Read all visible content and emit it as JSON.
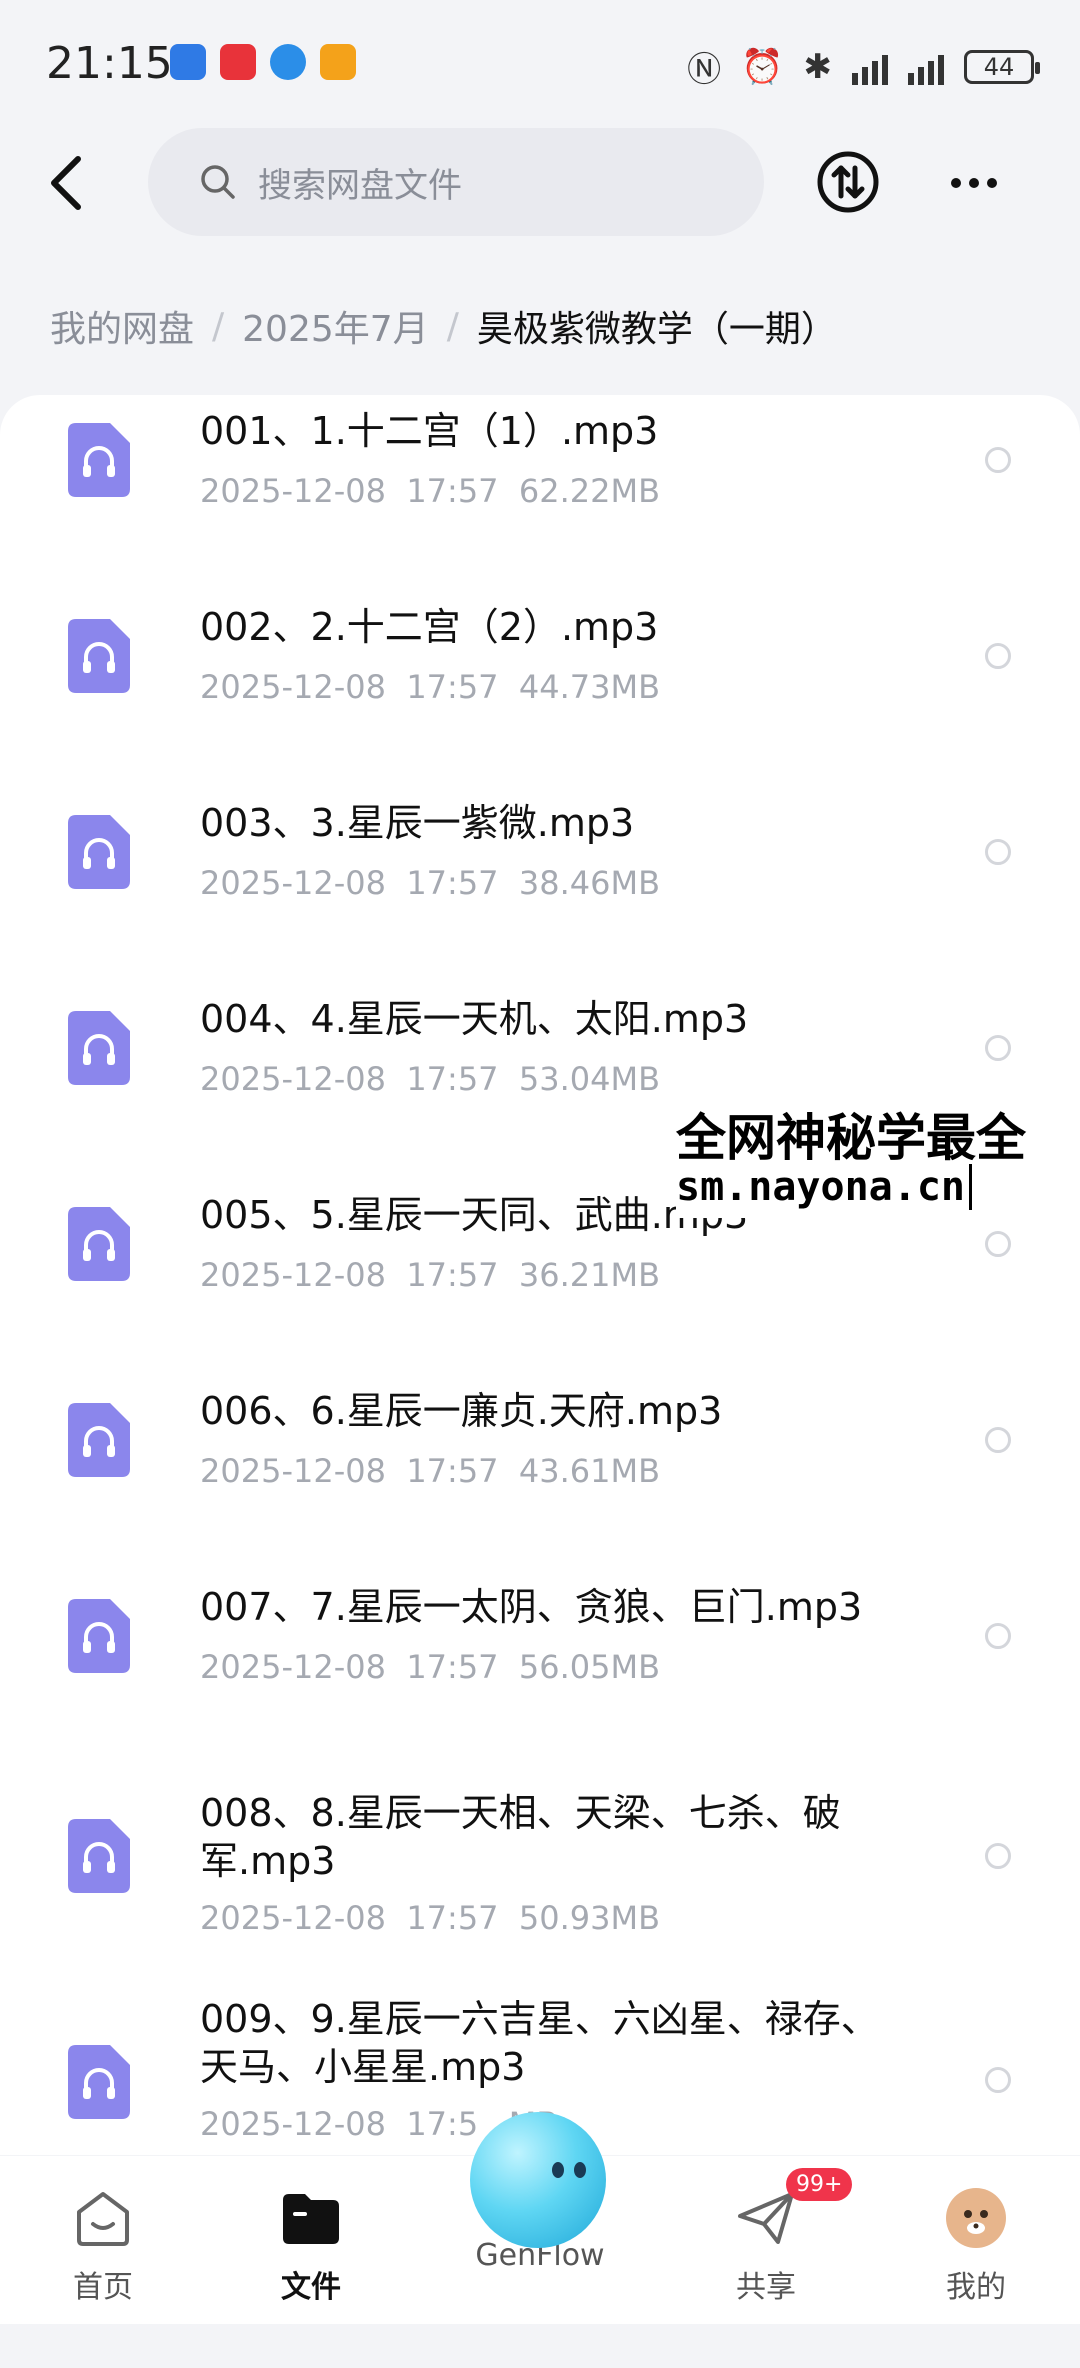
{
  "status_bar": {
    "time": "21:15",
    "battery": "44",
    "app_colors": [
      "#2f7ae5",
      "#e8333a",
      "#2b8ee8",
      "#f4a21a"
    ]
  },
  "header": {
    "search_placeholder": "搜索网盘文件",
    "icons": [
      "back-icon",
      "search-icon",
      "sort-icon",
      "more-icon"
    ]
  },
  "breadcrumb": [
    "我的网盘",
    "2025年7月",
    "昊极紫微教学（一期）"
  ],
  "files": [
    {
      "name": "001、1.十二宫（1）.mp3",
      "date": "2025-12-08  17:57",
      "size": "62.22MB"
    },
    {
      "name": "002、2.十二宫（2）.mp3",
      "date": "2025-12-08  17:57",
      "size": "44.73MB"
    },
    {
      "name": "003、3.星辰一紫微.mp3",
      "date": "2025-12-08  17:57",
      "size": "38.46MB"
    },
    {
      "name": "004、4.星辰一天机、太阳.mp3",
      "date": "2025-12-08  17:57",
      "size": "53.04MB"
    },
    {
      "name": "005、5.星辰一天同、武曲.mp3",
      "date": "2025-12-08  17:57",
      "size": "36.21MB"
    },
    {
      "name": "006、6.星辰一廉贞.天府.mp3",
      "date": "2025-12-08  17:57",
      "size": "43.61MB"
    },
    {
      "name": "007、7.星辰一太阴、贪狼、巨门.mp3",
      "date": "2025-12-08  17:57",
      "size": "56.05MB"
    },
    {
      "name": "008、8.星辰一天相、天梁、七杀、破军.mp3",
      "date": "2025-12-08  17:57",
      "size": "50.93MB"
    },
    {
      "name": "009、9.星辰一六吉星、六凶星、禄存、天马、小星星.mp3",
      "date": "2025-12-08  17:5",
      "size": "MB"
    }
  ],
  "watermark": {
    "line1": "全网神秘学最全",
    "line2": "sm.nayona.cn"
  },
  "bottom_nav": {
    "items": [
      {
        "label": "首页",
        "icon": "home-icon"
      },
      {
        "label": "文件",
        "icon": "folder-icon"
      },
      {
        "label": "GenFlow",
        "icon": "genflow-icon"
      },
      {
        "label": "共享",
        "icon": "share-icon"
      },
      {
        "label": "我的",
        "icon": "avatar-icon"
      }
    ],
    "share_badge": "99+",
    "active": "文件"
  },
  "colors": {
    "file_icon": "#8b86ec",
    "accent": "#111111",
    "badge": "#f0344b"
  }
}
